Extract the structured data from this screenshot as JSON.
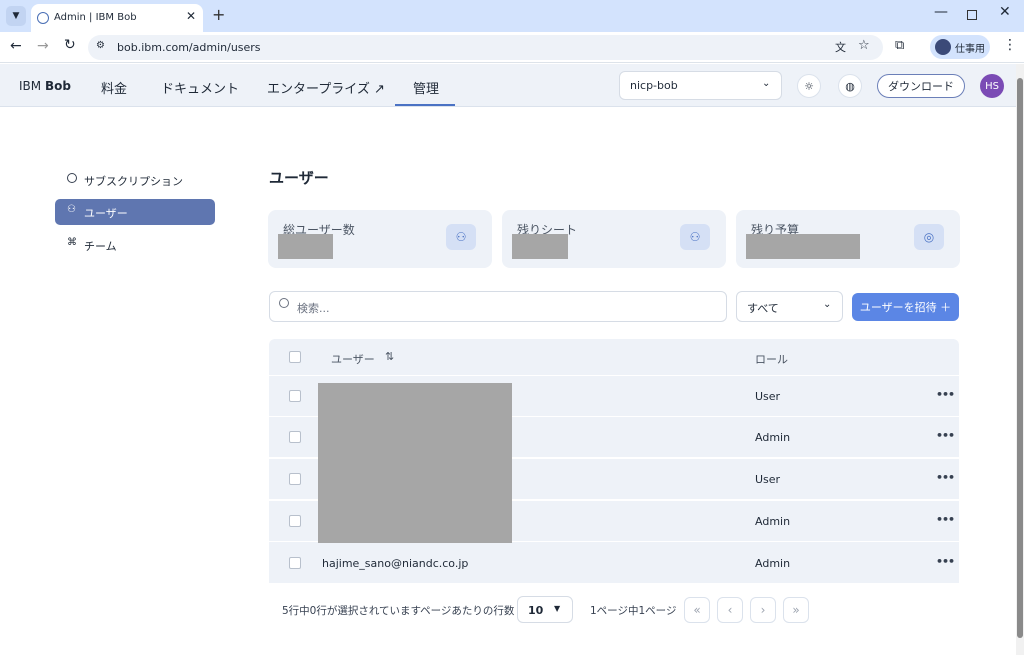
{
  "browser": {
    "tab_title": "Admin | IBM Bob",
    "url": "bob.ibm.com/admin/users",
    "profile_label": "仕事用"
  },
  "nav": {
    "brand_ibm": "IBM",
    "brand_bob": "Bob",
    "items": [
      "料金",
      "ドキュメント",
      "エンタープライズ ↗",
      "管理"
    ],
    "org_select": "nicp-bob",
    "download": "ダウンロード",
    "avatar": "HS"
  },
  "sidebar": {
    "items": [
      "サブスクリプション",
      "ユーザー",
      "チーム"
    ]
  },
  "main": {
    "title": "ユーザー",
    "stats": [
      {
        "label": "総ユーザー数"
      },
      {
        "label": "残りシート"
      },
      {
        "label": "残り予算"
      }
    ],
    "search_placeholder": "検索...",
    "filter": "すべて",
    "invite": "ユーザーを招待 ＋",
    "table": {
      "col_user": "ユーザー",
      "col_role": "ロール",
      "rows": [
        {
          "email": "",
          "role": "User"
        },
        {
          "email": "",
          "role": "Admin"
        },
        {
          "email": "",
          "role": "User"
        },
        {
          "email": "",
          "role": "Admin"
        },
        {
          "email": "hajime_sano@niandc.co.jp",
          "role": "Admin"
        }
      ]
    },
    "pagination": {
      "selected_text": "5行中0行が選択されています",
      "per_page_label": "ページあたりの行数",
      "per_page": "10",
      "page_text": "1ページ中1ページ"
    }
  }
}
